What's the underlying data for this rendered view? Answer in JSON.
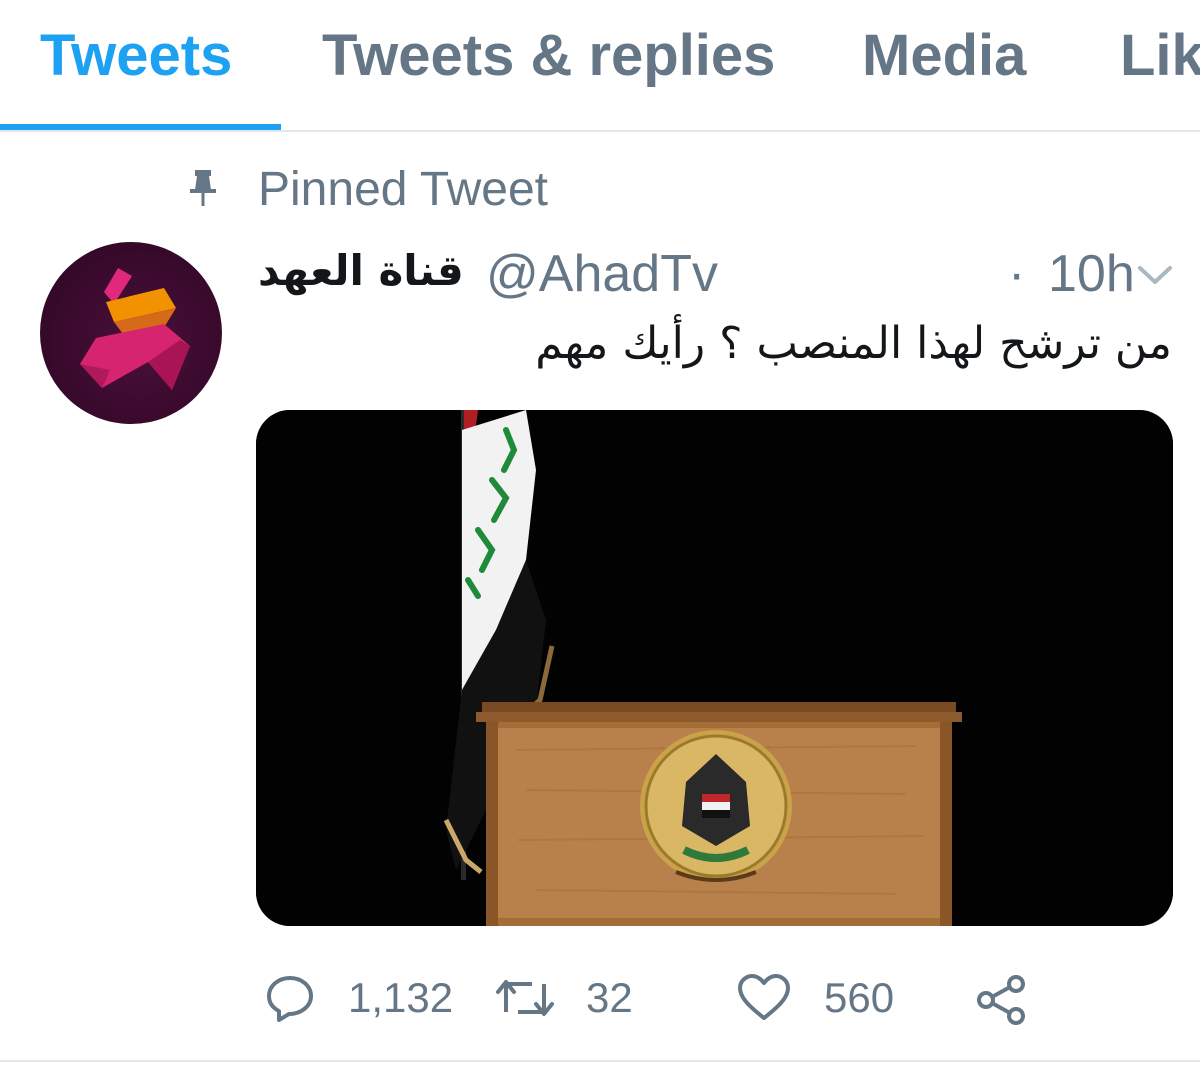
{
  "tabs": [
    {
      "label": "Tweets",
      "active": true
    },
    {
      "label": "Tweets & replies",
      "active": false
    },
    {
      "label": "Media",
      "active": false
    },
    {
      "label": "Lik",
      "active": false
    }
  ],
  "pinned": {
    "label": "Pinned Tweet",
    "icon": "pin-icon"
  },
  "tweet": {
    "display_name": "قناة العهد",
    "handle": "@AhadTv",
    "separator": "·",
    "time": "10h",
    "text": "من ترشح لهذا المنصب ؟ رأيك مهم",
    "avatar_colors": {
      "background": "#3a0a2d",
      "accent_pink": "#d6246e",
      "accent_orange": "#f39200"
    }
  },
  "actions": {
    "reply": {
      "icon": "reply-icon",
      "count": "1,132"
    },
    "retweet": {
      "icon": "retweet-icon",
      "count": "32"
    },
    "like": {
      "icon": "heart-icon",
      "count": "560"
    },
    "share": {
      "icon": "share-icon"
    }
  },
  "colors": {
    "accent": "#1da1f2",
    "secondary_text": "#657786",
    "divider": "#e1e8ed"
  }
}
